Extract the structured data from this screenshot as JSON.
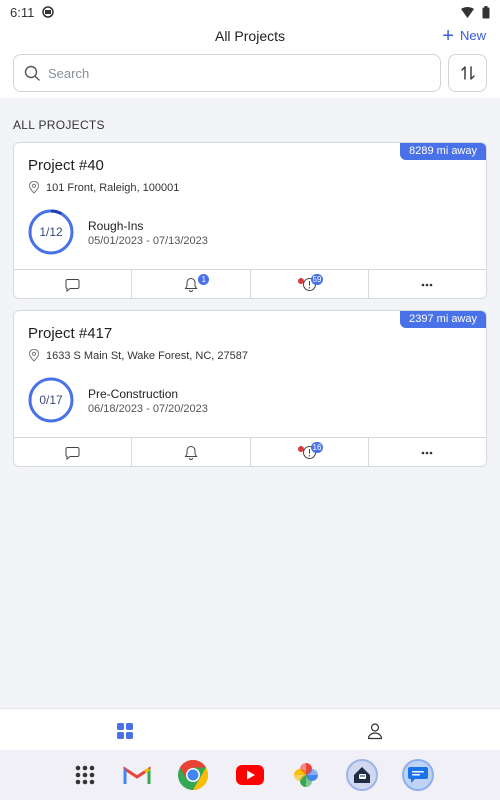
{
  "status_bar": {
    "time": "6:11"
  },
  "header": {
    "title": "All Projects",
    "new_label": "New",
    "search_placeholder": "Search"
  },
  "section_label": "ALL PROJECTS",
  "projects": [
    {
      "name": "Project #40",
      "distance": "8289 mi away",
      "address": "101 Front, Raleigh, 100001",
      "progress_label": "1/12",
      "progress_fraction": 0.0833,
      "phase": "Rough-Ins",
      "dates": "05/01/2023 - 07/13/2023",
      "notification_badge": "1",
      "task_badge": "59"
    },
    {
      "name": "Project #417",
      "distance": "2397 mi away",
      "address": "1633 S Main St, Wake Forest, NC, 27587",
      "progress_label": "0/17",
      "progress_fraction": 0,
      "phase": "Pre-Construction",
      "dates": "06/18/2023 - 07/20/2023",
      "notification_badge": "",
      "task_badge": "16"
    }
  ],
  "colors": {
    "accent": "#4a72e8",
    "alert_dot": "#d93a3a"
  },
  "icons": {
    "search": "search-icon",
    "sort": "sort-icon",
    "location": "location-pin-icon",
    "comment": "comment-icon",
    "bell": "bell-icon",
    "tasks": "tasks-icon",
    "more": "more-dots-icon",
    "projects_tab": "grid-icon",
    "profile_tab": "person-icon"
  }
}
